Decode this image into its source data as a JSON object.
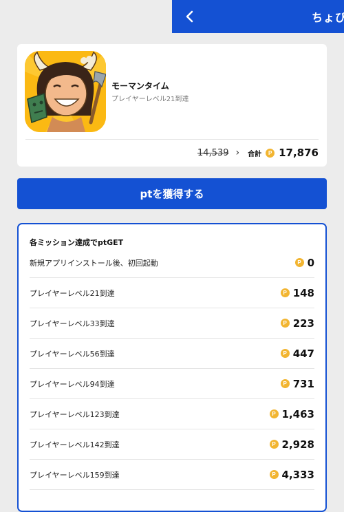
{
  "header": {
    "title": "ちょびリッチ"
  },
  "app": {
    "name": "モーマンタイム",
    "condition": "プレイヤーレベル21到達",
    "old_points": "14,539",
    "total_label": "合計",
    "total_points": "17,876"
  },
  "cta": {
    "label": "ptを獲得する"
  },
  "missions": {
    "title": "各ミッション達成でptGET",
    "items": [
      {
        "label": "新規アプリインストール後、初回起動",
        "points": "0"
      },
      {
        "label": "プレイヤーレベル21到達",
        "points": "148"
      },
      {
        "label": "プレイヤーレベル33到達",
        "points": "223"
      },
      {
        "label": "プレイヤーレベル56到達",
        "points": "447"
      },
      {
        "label": "プレイヤーレベル94到達",
        "points": "731"
      },
      {
        "label": "プレイヤーレベル123到達",
        "points": "1,463"
      },
      {
        "label": "プレイヤーレベル142到達",
        "points": "2,928"
      },
      {
        "label": "プレイヤーレベル159到達",
        "points": "4,333"
      }
    ]
  },
  "icons": {
    "coin": "P",
    "back": "chevron-left-icon",
    "arrow": "›"
  },
  "colors": {
    "brand": "#1451d3",
    "coin": "#f2b531",
    "background": "#ececec"
  }
}
